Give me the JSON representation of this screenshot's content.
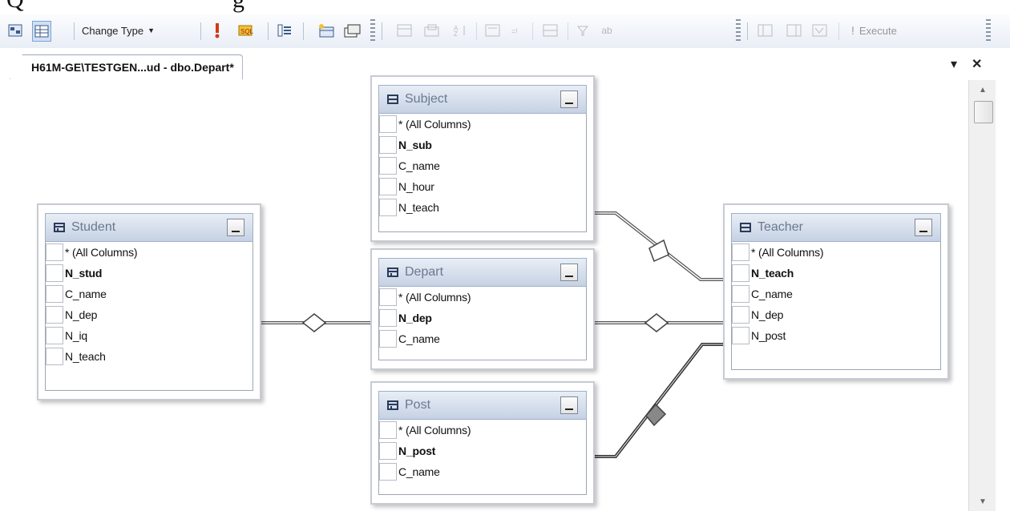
{
  "toolbar": {
    "change_type_label": "Change Type",
    "execute_label": "Execute"
  },
  "document_tab": {
    "title": "H61M-GE\\TESTGEN...ud - dbo.Depart*"
  },
  "tab_controls": {
    "dropdown": "▾",
    "close": "✕"
  },
  "tables": {
    "student": {
      "name": "Student",
      "columns": [
        "* (All Columns)",
        "N_stud",
        "C_name",
        "N_dep",
        "N_iq",
        "N_teach"
      ]
    },
    "subject": {
      "name": "Subject",
      "columns": [
        "* (All Columns)",
        "N_sub",
        "C_name",
        "N_hour",
        "N_teach"
      ]
    },
    "depart": {
      "name": "Depart",
      "columns": [
        "* (All Columns)",
        "N_dep",
        "C_name"
      ]
    },
    "post": {
      "name": "Post",
      "columns": [
        "* (All Columns)",
        "N_post",
        "C_name"
      ]
    },
    "teacher": {
      "name": "Teacher",
      "columns": [
        "* (All Columns)",
        "N_teach",
        "C_name",
        "N_dep",
        "N_post"
      ]
    }
  }
}
